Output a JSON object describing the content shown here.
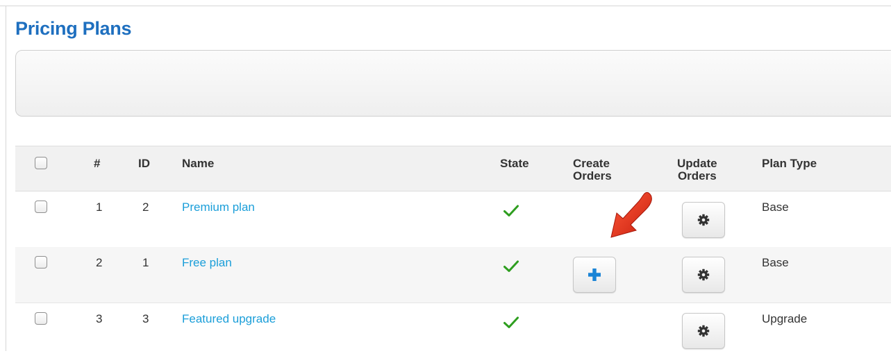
{
  "page": {
    "title": "Pricing Plans"
  },
  "table": {
    "headers": {
      "number": "#",
      "id": "ID",
      "name": "Name",
      "state": "State",
      "create_orders_line1": "Create",
      "create_orders_line2": "Orders",
      "update_orders_line1": "Update",
      "update_orders_line2": "Orders",
      "plan_type": "Plan Type"
    },
    "rows": [
      {
        "number": "1",
        "id": "2",
        "name": "Premium plan",
        "state": "published",
        "create_orders": false,
        "plan_type": "Base"
      },
      {
        "number": "2",
        "id": "1",
        "name": "Free plan",
        "state": "published",
        "create_orders": true,
        "plan_type": "Base"
      },
      {
        "number": "3",
        "id": "3",
        "name": "Featured upgrade",
        "state": "published",
        "create_orders": false,
        "plan_type": "Upgrade"
      }
    ]
  },
  "icons": {
    "state": "check-icon",
    "create_orders": "plus-icon",
    "update_orders": "gear-icon",
    "annotation": "red-arrow-icon"
  },
  "colors": {
    "title": "#1e6fbf",
    "link": "#1a9ed9",
    "check": "#2e9e1f",
    "plus": "#1a84d6",
    "arrow": "#e8361f"
  }
}
